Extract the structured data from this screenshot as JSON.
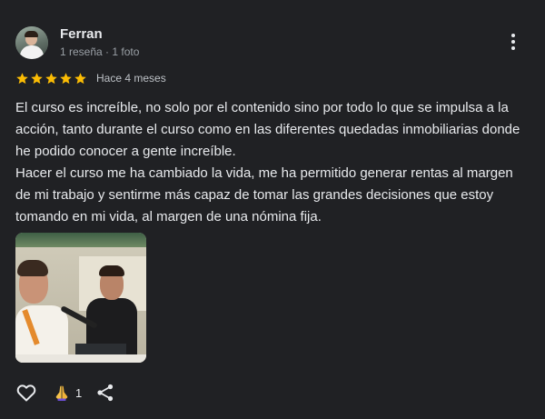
{
  "review": {
    "author": {
      "name": "Ferran",
      "meta": "1 reseña · 1 foto",
      "avatar_icon": "user-avatar-photo"
    },
    "rating": {
      "stars": 5,
      "max_stars": 5,
      "star_color": "#fbbc04",
      "date": "Hace 4 meses"
    },
    "text": {
      "paragraph_1": "El curso es increíble, no solo por el contenido sino por todo lo que se impulsa a la acción, tanto durante el curso como en las diferentes quedadas inmobiliarias donde he podido conocer a gente increíble.",
      "paragraph_2": "Hacer el curso me ha cambiado la vida, me ha permitido generar rentas al margen de mi trabajo y sentirme más capaz de tomar las grandes decisiones que estoy tomando en mi vida, al margen de una nómina fija."
    },
    "photo": {
      "icon": "review-photo-thumbnail"
    },
    "actions": {
      "like_icon": "heart-outline-icon",
      "reaction_icon": "praying-hands-emoji",
      "reaction_count": "1",
      "share_icon": "share-icon"
    },
    "more_options_icon": "more-vert-icon"
  },
  "colors": {
    "background": "#202124",
    "primary_text": "#e8eaed",
    "secondary_text": "#9aa0a6",
    "star": "#fbbc04"
  }
}
